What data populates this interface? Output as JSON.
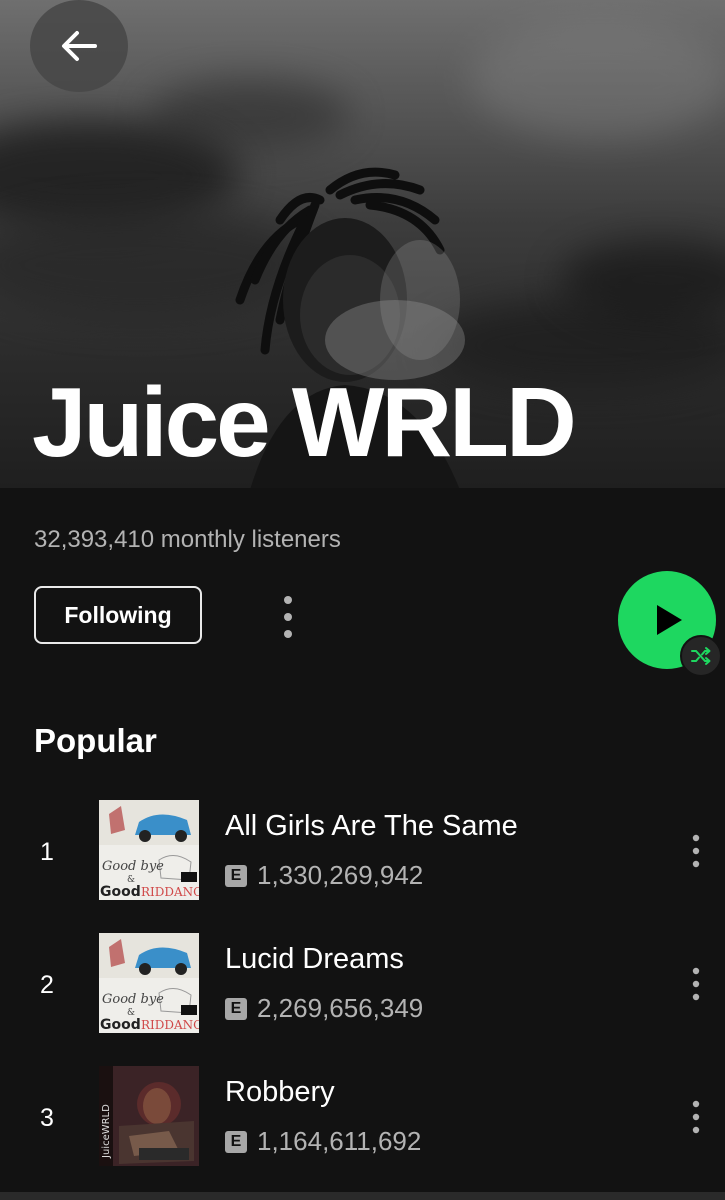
{
  "artist": {
    "name": "Juice WRLD",
    "monthly_listeners": "32,393,410 monthly listeners"
  },
  "actions": {
    "follow_label": "Following",
    "back_icon": "arrow-left-icon",
    "more_icon": "more-vertical-icon",
    "play_icon": "play-icon",
    "shuffle_icon": "shuffle-icon"
  },
  "popular": {
    "title": "Popular",
    "tracks": [
      {
        "rank": "1",
        "title": "All Girls Are The Same",
        "explicit": "E",
        "plays": "1,330,269,942"
      },
      {
        "rank": "2",
        "title": "Lucid Dreams",
        "explicit": "E",
        "plays": "2,269,656,349"
      },
      {
        "rank": "3",
        "title": "Robbery",
        "explicit": "E",
        "plays": "1,164,611,692"
      }
    ]
  },
  "colors": {
    "accent": "#1ed760",
    "background": "#121212",
    "secondary_text": "#b3b3b3"
  }
}
